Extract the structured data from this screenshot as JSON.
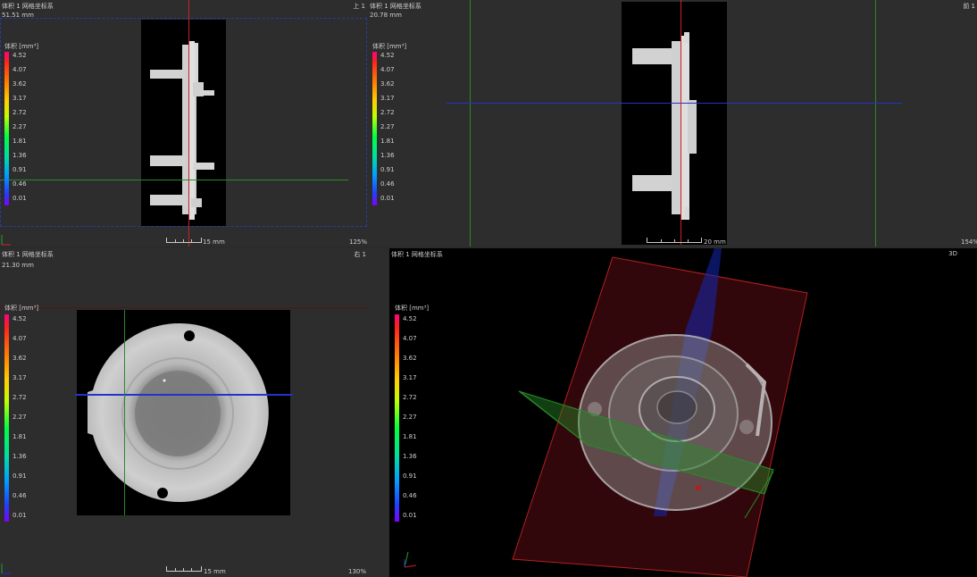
{
  "legend": {
    "title": "体积 [mm³]",
    "values": [
      "4.52",
      "4.07",
      "3.62",
      "3.17",
      "2.72",
      "2.27",
      "1.81",
      "1.36",
      "0.91",
      "0.46",
      "0.01"
    ]
  },
  "views": {
    "top": {
      "title": "体积 1 网格坐标系",
      "distance": "51.51 mm",
      "label": "上 1",
      "scale": "15 mm",
      "zoom": "125%"
    },
    "front": {
      "title": "体积 1 网格坐标系",
      "distance": "20.78 mm",
      "label": "前 1",
      "scale": "20 mm",
      "zoom": "154%"
    },
    "right": {
      "title": "体积 1 网格坐标系",
      "distance": "21.30 mm",
      "label": "右 1",
      "scale": "15 mm",
      "zoom": "130%"
    },
    "three_d": {
      "title": "体积 1 网格坐标系",
      "label": "3D"
    }
  },
  "colors": {
    "background": "#2d2d2d",
    "slice_red": "#cc2222",
    "slice_green": "#2a8a2a",
    "slice_blue": "#2233cc"
  },
  "icons": [
    "axis-triad-icon"
  ]
}
